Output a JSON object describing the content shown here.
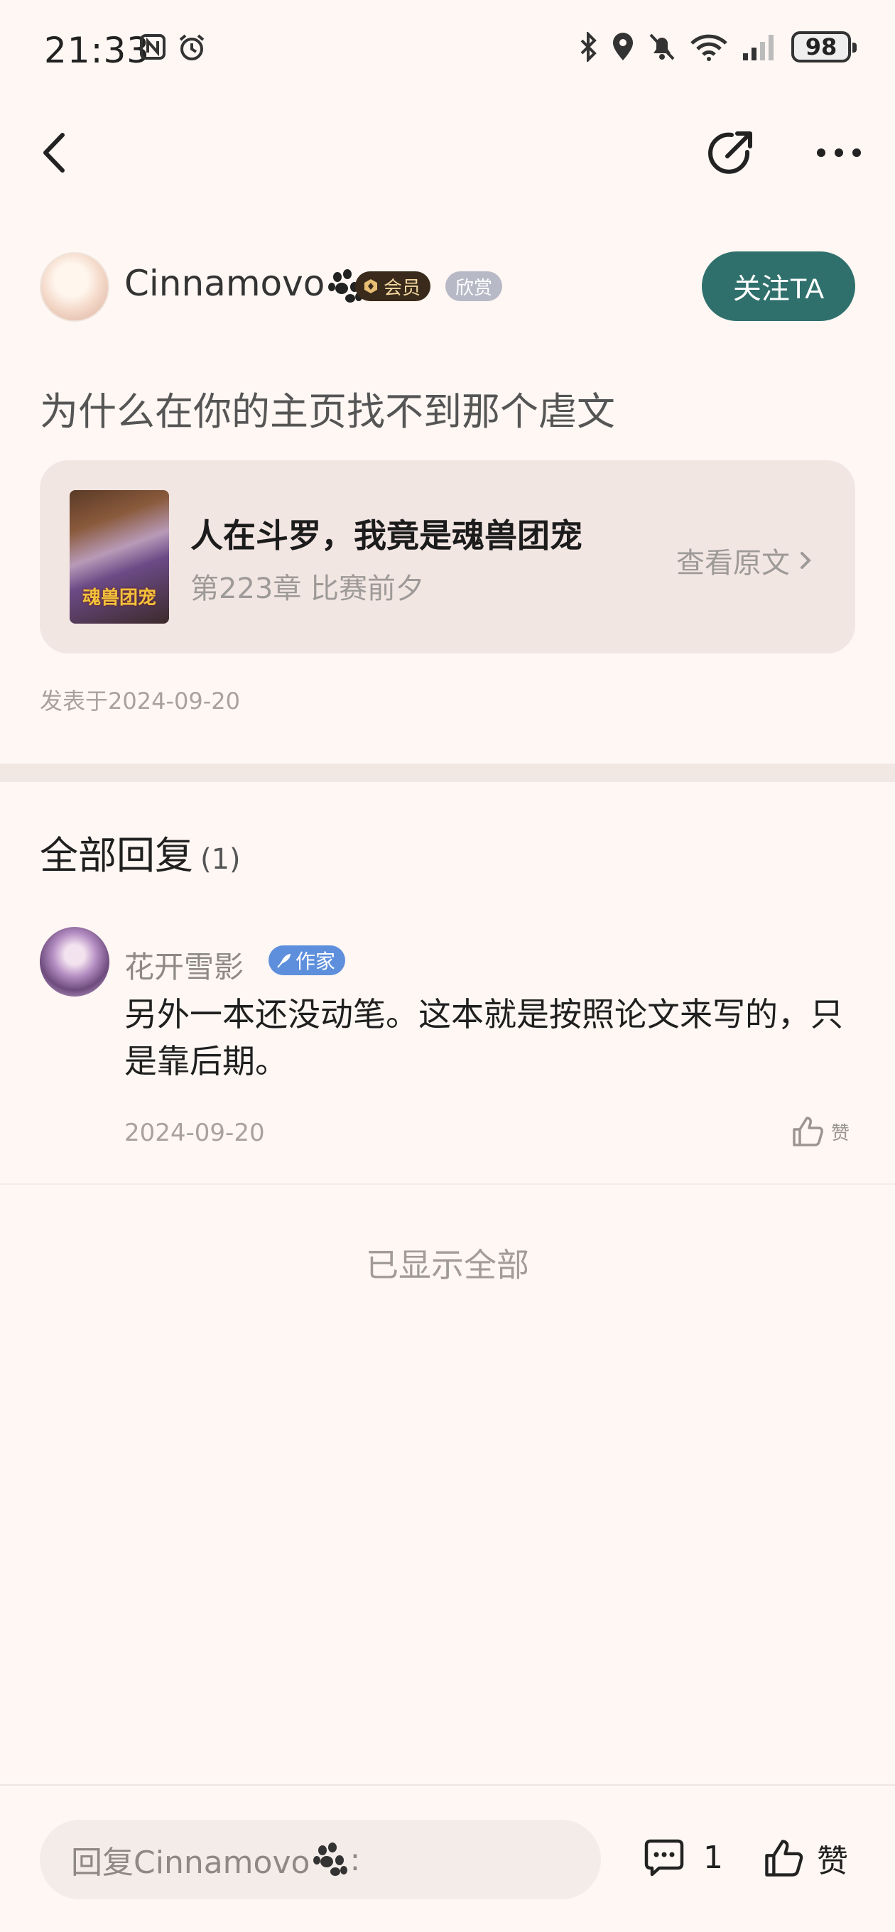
{
  "status_bar": {
    "time": "21:33",
    "battery": "98"
  },
  "post": {
    "author_name": "Cinnamovo",
    "badge_vip": "会员",
    "badge_appreciate": "欣赏",
    "follow_label": "关注TA",
    "text": "为什么在你的主页找不到那个虐文",
    "date": "发表于2024-09-20"
  },
  "book": {
    "title": "人在斗罗，我竟是魂兽团宠",
    "chapter": "第223章 比赛前夕",
    "view_original": "查看原文",
    "cover_text": "魂兽团宠"
  },
  "replies": {
    "title": "全部回复",
    "count": "(1)",
    "items": [
      {
        "name": "花开雪影",
        "badge": "作家",
        "text": "另外一本还没动笔。这本就是按照论文来写的，只是靠后期。",
        "date": "2024-09-20",
        "like_label": "赞"
      }
    ],
    "end_label": "已显示全部"
  },
  "bottom_bar": {
    "reply_placeholder": "回复Cinnamovo",
    "reply_suffix": ":",
    "comment_count": "1",
    "like_label": "赞"
  },
  "colors": {
    "background": "#FEF7F3",
    "follow_button": "#2F706C",
    "author_badge": "#5E8FDC",
    "vip_badge": "#3A2A1B"
  },
  "icons": [
    "back-icon",
    "share-icon",
    "more-icon",
    "paw-icon",
    "comment-icon",
    "thumbs-up-icon",
    "chevron-right-icon"
  ]
}
